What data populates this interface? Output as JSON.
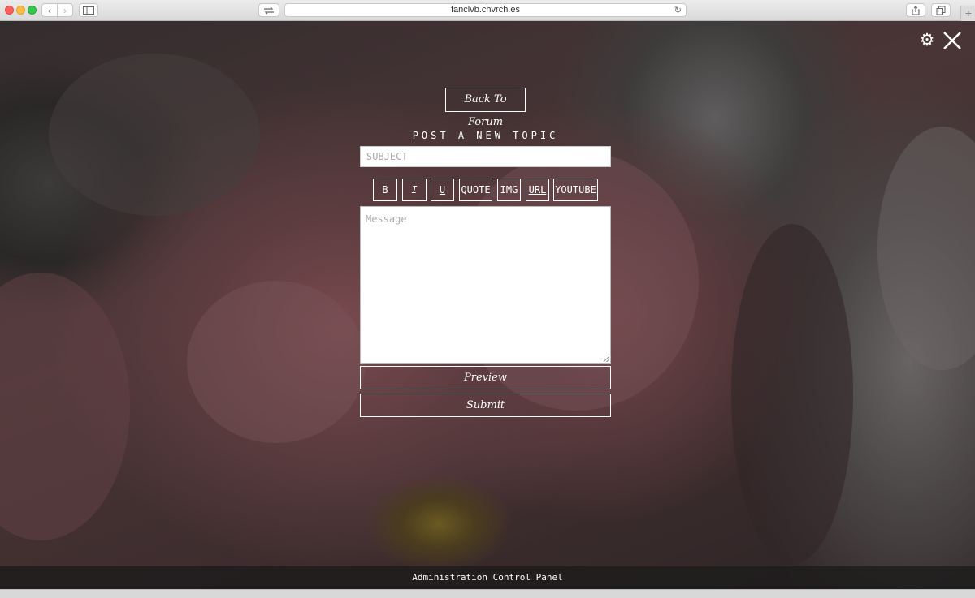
{
  "browser": {
    "url": "fanclvb.chvrch.es",
    "back_icon": "‹",
    "forward_icon": "›",
    "reload_icon": "↻",
    "newtab_icon": "+"
  },
  "page": {
    "back_to_forum": "Back To Forum",
    "heading": "POST A NEW TOPIC",
    "subject_placeholder": "SUBJECT",
    "message_placeholder": "Message",
    "format_buttons": {
      "bold": "B",
      "italic": "I",
      "underline": "U",
      "quote": "QUOTE",
      "img": "IMG",
      "url": "URL",
      "youtube": "YOUTUBE"
    },
    "preview_label": "Preview",
    "submit_label": "Submit",
    "settings_icon": "⚙",
    "footer": "Administration Control Panel"
  }
}
